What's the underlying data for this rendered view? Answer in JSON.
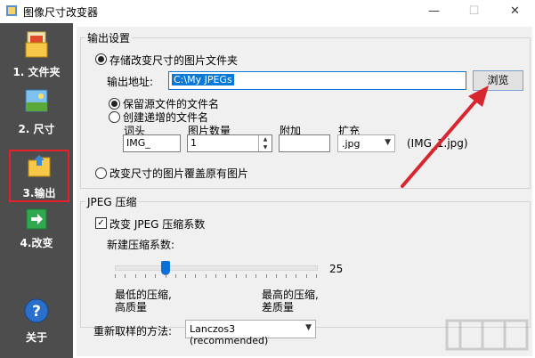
{
  "window": {
    "title": "图像尺寸改变器",
    "minimize": "—",
    "maximize": "☐",
    "close": "✕"
  },
  "sidebar": {
    "items": [
      {
        "label": "1. 文件夹",
        "icon": "folder-icon"
      },
      {
        "label": "2. 尺寸",
        "icon": "resize-image-icon"
      },
      {
        "label": "3.输出",
        "icon": "output-folder-icon"
      },
      {
        "label": "4.改变",
        "icon": "arrow-right-icon"
      },
      {
        "label": "关于",
        "icon": "help-icon"
      }
    ]
  },
  "output": {
    "group_title": "输出设置",
    "store_radio": "存储改变尺寸的图片文件夹",
    "address_label": "输出地址:",
    "address_value": "C:\\My JPEGs",
    "browse_label": "浏览",
    "keep_name_radio": "保留源文件的文件名",
    "incr_name_radio": "创建递增的文件名",
    "prefix_label": "词头",
    "prefix_value": "IMG_",
    "count_label": "图片数量",
    "count_value": "1",
    "append_label": "附加",
    "append_value": "",
    "ext_label": "扩充",
    "ext_value": ".jpg",
    "preview": "(IMG_1.jpg)",
    "overwrite_radio": "改变尺寸的图片覆盖原有图片"
  },
  "jpeg": {
    "group_title": "JPEG 压缩",
    "change_check": "改变 JPEG 压缩系数",
    "new_factor_label": "新建压缩系数:",
    "slider_value": "25",
    "slider_fraction": 0.25,
    "low_label_line1": "最低的压缩,",
    "low_label_line2": "高质量",
    "high_label_line1": "最高的压缩,",
    "high_label_line2": "差质量"
  },
  "resample": {
    "label": "重新取样的方法:",
    "value": "Lanczos3 (recommended)"
  },
  "colors": {
    "sidebar_bg": "#4d4d4d",
    "highlight": "#e8202a",
    "address_bg": "#0a78d7"
  }
}
